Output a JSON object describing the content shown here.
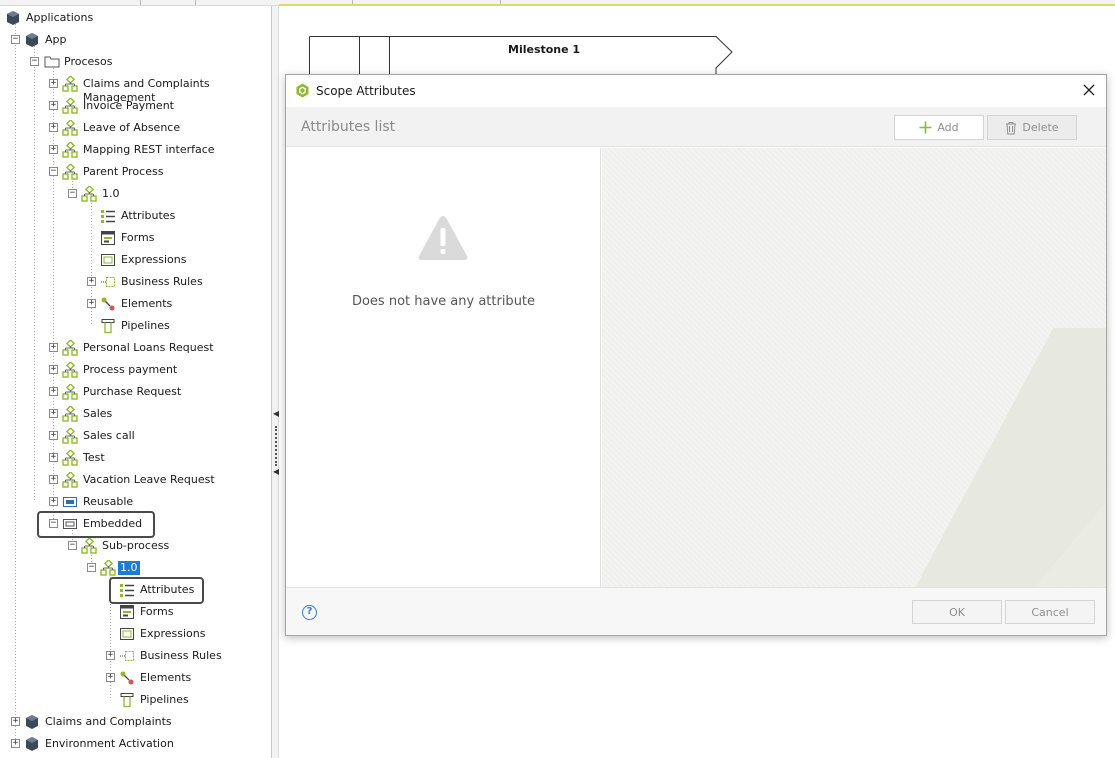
{
  "tree": {
    "root": "Applications",
    "app": "App",
    "procesos": "Procesos",
    "processes_top": [
      "Claims and Complaints Management",
      "Invoice Payment",
      "Leave of Absence",
      "Mapping REST interface"
    ],
    "parent_process": "Parent Process",
    "parent_version": "1.0",
    "parent_children": [
      "Attributes",
      "Forms",
      "Expressions",
      "Business Rules",
      "Elements",
      "Pipelines"
    ],
    "processes_bottom": [
      "Personal Loans Request",
      "Process payment",
      "Purchase Request",
      "Sales",
      "Sales call",
      "Test",
      "Vacation Leave Request"
    ],
    "reusable": "Reusable",
    "embedded": "Embedded",
    "sub_process": "Sub-process",
    "sub_version": "1.0",
    "sub_children": [
      "Attributes",
      "Forms",
      "Expressions",
      "Business Rules",
      "Elements",
      "Pipelines"
    ],
    "other_apps": [
      "Claims and Complaints",
      "Environment Activation"
    ]
  },
  "canvas": {
    "milestone_label": "Milestone 1"
  },
  "dialog": {
    "title": "Scope Attributes",
    "list_header": "Attributes list",
    "add_label": "Add",
    "delete_label": "Delete",
    "empty_message": "Does not have any attribute",
    "ok_label": "OK",
    "cancel_label": "Cancel",
    "help_glyph": "?"
  },
  "colors": {
    "selection": "#1a7cd3",
    "process_icon_green": "#8dbb2c",
    "app_icon": "#3b4a5a",
    "help_blue": "#2f7fcf"
  }
}
